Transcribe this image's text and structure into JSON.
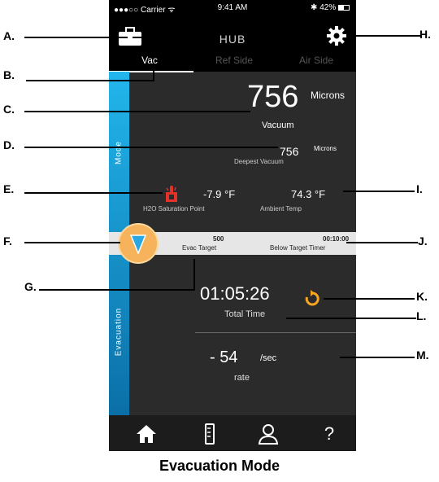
{
  "status_bar": {
    "carrier": "●●●○○ Carrier ᯤ",
    "time": "9:41 AM",
    "battery": "✱ 42%"
  },
  "header": {
    "title": "HUB"
  },
  "tabs": [
    {
      "label": "Vac"
    },
    {
      "label": "Ref Side"
    },
    {
      "label": "Air Side"
    }
  ],
  "side": {
    "mode_label": "Mode",
    "evac_label": "Evacuation"
  },
  "vacuum": {
    "value": "756",
    "unit": "Microns",
    "label": "Vacuum"
  },
  "deepest": {
    "value": "756",
    "unit": "Microns",
    "label": "Deepest Vacuum"
  },
  "h2o": {
    "value": "-7.9 °F",
    "label": "H2O Saturation Point"
  },
  "ambient": {
    "value": "74.3 °F",
    "label": "Ambient Temp"
  },
  "evac_target": {
    "value": "500",
    "label": "Evac Target"
  },
  "below_timer": {
    "value": "00:10:00",
    "label": "Below Target Timer"
  },
  "total_time": {
    "value": "01:05:26",
    "label": "Total Time"
  },
  "rate": {
    "value": "- 54",
    "unit": "/sec",
    "label": "rate"
  },
  "nav": {
    "help": "?"
  },
  "callouts": {
    "left": [
      "A.",
      "B.",
      "C.",
      "D.",
      "E.",
      "F.",
      "G."
    ],
    "right": [
      "H.",
      "I.",
      "J.",
      "K.",
      "L.",
      "M."
    ]
  },
  "caption": "Evacuation Mode",
  "colors": {
    "accent_blue": "#22b6ec",
    "orange": "#f6b35b",
    "red_icon": "#e4322b",
    "dark_bg": "#2b2b2b"
  },
  "icons": [
    "toolbox-icon",
    "gear-icon",
    "thermometer-icon",
    "triangle-down-icon",
    "reset-icon",
    "home-icon",
    "manifold-icon",
    "user-icon",
    "help-icon"
  ]
}
